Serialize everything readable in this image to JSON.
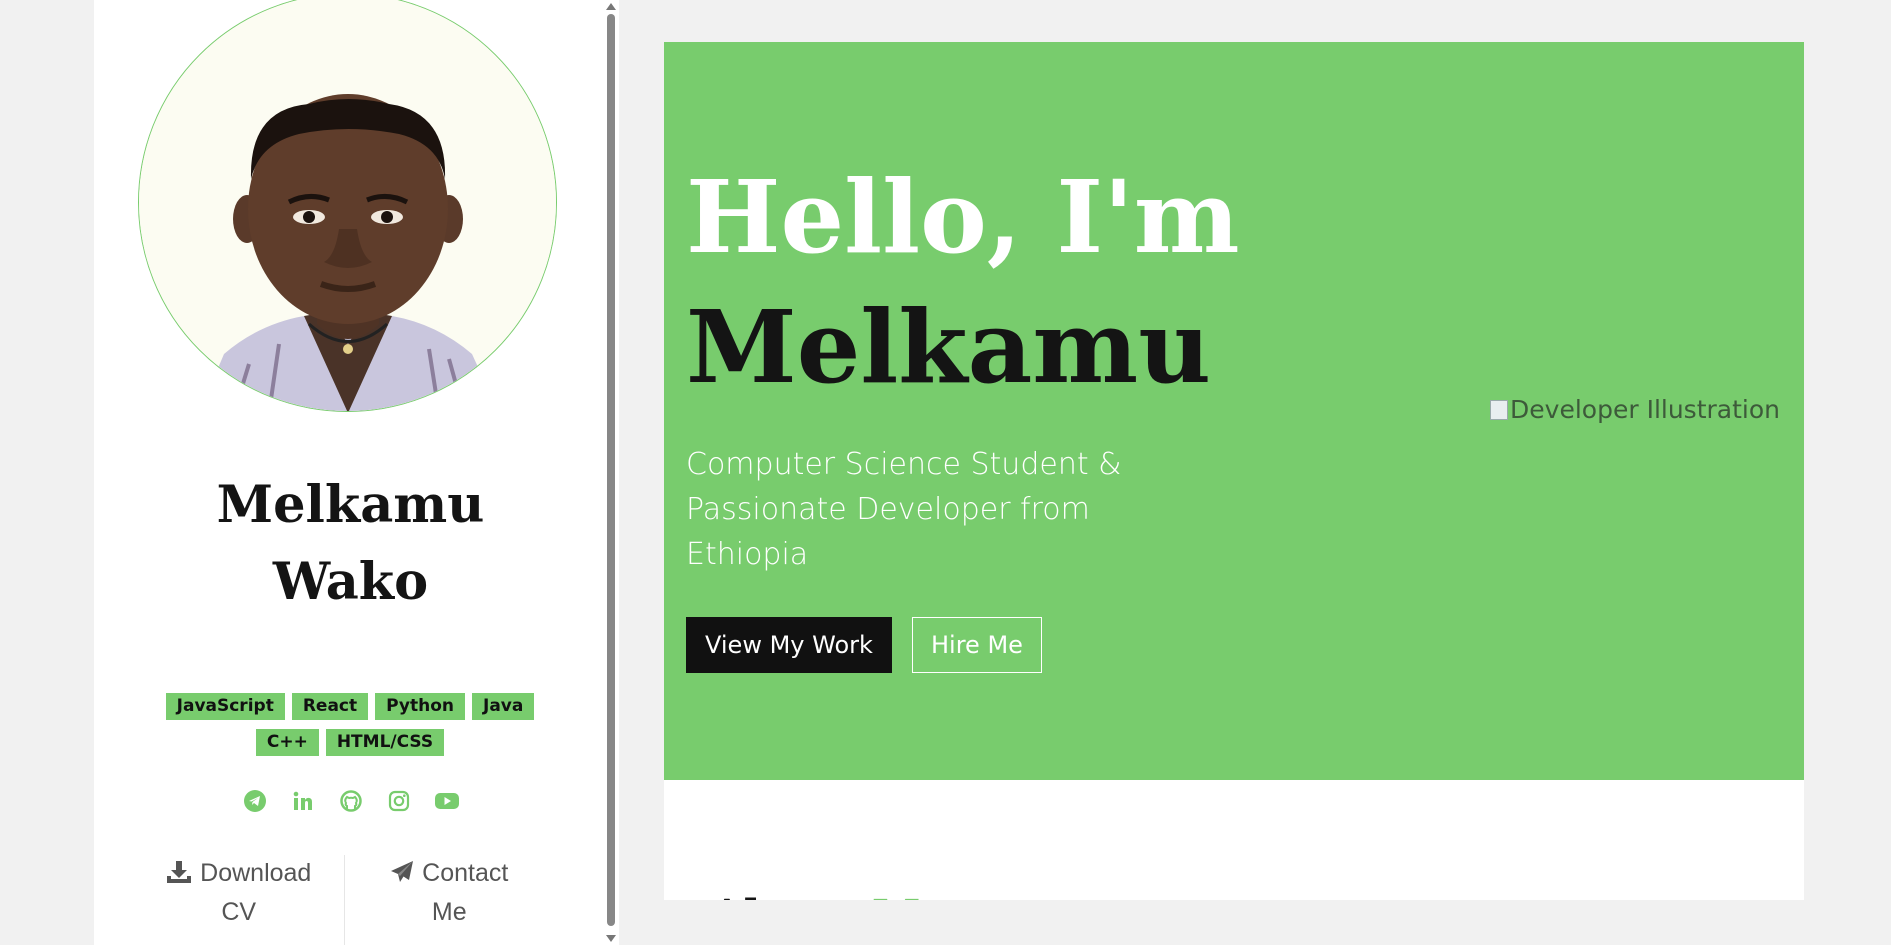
{
  "profile": {
    "first_name": "Melkamu",
    "last_name": "Wako"
  },
  "skills": [
    "JavaScript",
    "React",
    "Python",
    "Java",
    "C++",
    "HTML/CSS"
  ],
  "social_icons": [
    "telegram-icon",
    "linkedin-icon",
    "github-icon",
    "instagram-icon",
    "youtube-icon"
  ],
  "actions": {
    "download_line1": "Download",
    "download_line2": "CV",
    "contact_line1": "Contact",
    "contact_line2": "Me"
  },
  "hero": {
    "greeting": "Hello, I'm",
    "name": "Melkamu",
    "tagline": "Computer Science Student & Passionate Developer from Ethiopia",
    "primary_button": "View My Work",
    "secondary_button": "Hire Me",
    "image_alt": "Developer Illustration"
  },
  "about": {
    "title_part1": "About",
    "title_part2": "Me"
  },
  "colors": {
    "accent": "#78cc6d",
    "dark": "#141414",
    "page_bg": "#f1f1f1"
  }
}
